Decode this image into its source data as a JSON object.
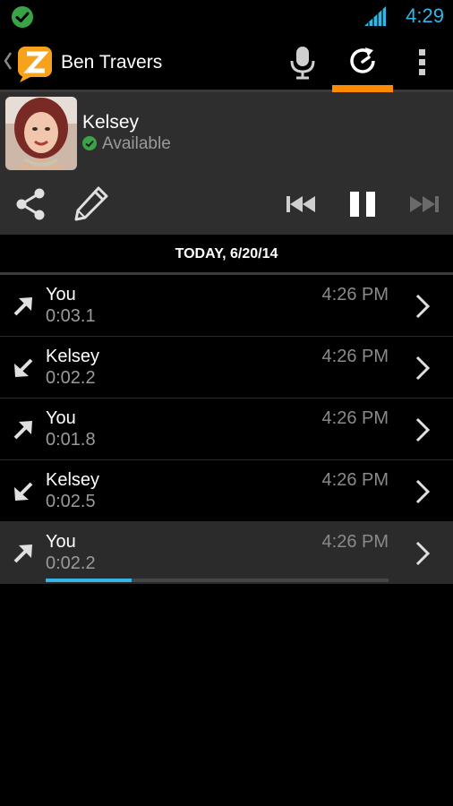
{
  "status_bar": {
    "time": "4:29"
  },
  "action_bar": {
    "title": "Ben Travers"
  },
  "contact": {
    "name": "Kelsey",
    "presence": "Available"
  },
  "date_header": "TODAY, 6/20/14",
  "messages": [
    {
      "sender": "You",
      "duration": "0:03.1",
      "time": "4:26 PM",
      "direction": "outgoing"
    },
    {
      "sender": "Kelsey",
      "duration": "0:02.2",
      "time": "4:26 PM",
      "direction": "incoming"
    },
    {
      "sender": "You",
      "duration": "0:01.8",
      "time": "4:26 PM",
      "direction": "outgoing"
    },
    {
      "sender": "Kelsey",
      "duration": "0:02.5",
      "time": "4:26 PM",
      "direction": "incoming"
    },
    {
      "sender": "You",
      "duration": "0:02.2",
      "time": "4:26 PM",
      "direction": "outgoing",
      "playing": true,
      "progress": 0.25
    }
  ],
  "colors": {
    "accent_blue": "#33b5e5",
    "tab_indicator": "#ff8a00",
    "presence_green": "#3aa346",
    "logo_orange": "#f7a21b"
  },
  "icons": [
    "check-icon",
    "signal-icon",
    "back-chevron-icon",
    "app-logo-icon",
    "microphone-icon",
    "history-icon",
    "overflow-menu-icon",
    "share-icon",
    "pencil-icon",
    "previous-icon",
    "pause-icon",
    "next-icon",
    "outgoing-arrow-icon",
    "incoming-arrow-icon",
    "chevron-right-icon"
  ]
}
